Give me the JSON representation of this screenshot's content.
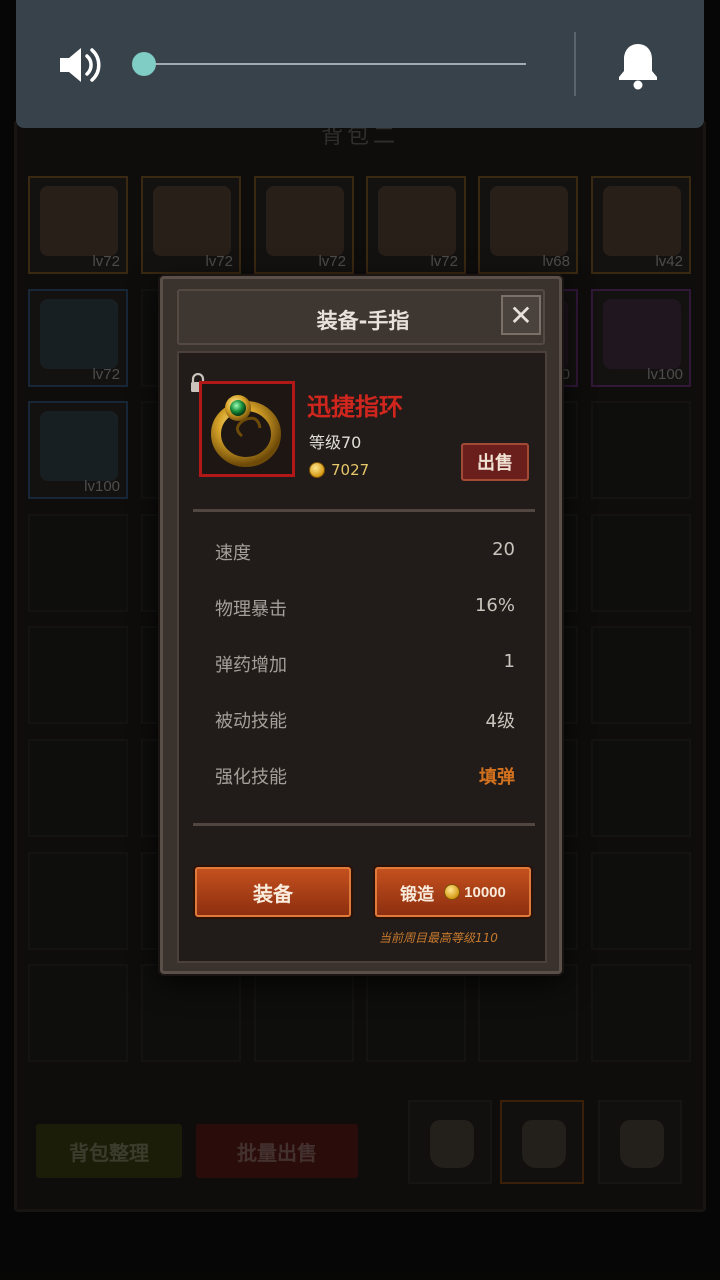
{
  "background": {
    "bag_title": "背包二",
    "grid_rows": [
      [
        {
          "level": "lv72",
          "rarity": "gold",
          "icon": "helmet-icon"
        },
        {
          "level": "lv72",
          "rarity": "gold",
          "icon": "helmet-icon"
        },
        {
          "level": "lv72",
          "rarity": "gold",
          "icon": "helmet-icon"
        },
        {
          "level": "lv72",
          "rarity": "gold",
          "icon": "shield-icon"
        },
        {
          "level": "lv68",
          "rarity": "gold",
          "icon": "gauntlet-icon"
        },
        {
          "level": "lv42",
          "rarity": "gold",
          "icon": "emblem-icon"
        }
      ],
      [
        {
          "level": "lv72",
          "rarity": "blue",
          "icon": "orb-icon"
        },
        {
          "level": "",
          "rarity": "",
          "icon": ""
        },
        {
          "level": "",
          "rarity": "",
          "icon": ""
        },
        {
          "level": "",
          "rarity": "",
          "icon": ""
        },
        {
          "level": "lv100",
          "rarity": "purple",
          "icon": "gem-icon"
        },
        {
          "level": "lv100",
          "rarity": "purple",
          "icon": "sword-icon"
        }
      ],
      [
        {
          "level": "lv100",
          "rarity": "blue",
          "icon": "armor-icon"
        },
        {
          "level": "",
          "rarity": "",
          "icon": ""
        },
        {
          "level": "",
          "rarity": "",
          "icon": ""
        },
        {
          "level": "",
          "rarity": "",
          "icon": ""
        },
        {
          "level": "",
          "rarity": "",
          "icon": ""
        },
        {
          "level": "",
          "rarity": "",
          "icon": ""
        }
      ]
    ],
    "empty_rows": 5,
    "sort_button": "背包整理",
    "bulk_sell_button": "批量出售",
    "bag_tabs": 3,
    "active_bag_tab": 2
  },
  "dialog": {
    "title": "装备-手指",
    "close_glyph": "✕",
    "item": {
      "name": "迅捷指环",
      "level_text": "等级70",
      "price": "7027",
      "icon": "ring-icon",
      "locked": true
    },
    "sell_button": "出售",
    "stats": [
      {
        "name": "速度",
        "value": "20",
        "highlight": false
      },
      {
        "name": "物理暴击",
        "value": "16%",
        "highlight": false
      },
      {
        "name": "弹药增加",
        "value": "1",
        "highlight": false
      },
      {
        "name": "被动技能",
        "value": "4级",
        "highlight": false
      },
      {
        "name": "强化技能",
        "value": "填弹",
        "highlight": true
      }
    ],
    "equip_button": "装备",
    "forge_button": "锻造",
    "forge_cost": "10000",
    "max_level_note": "当前周目最高等级110"
  },
  "volume_overlay": {
    "level": 0.0,
    "speaker_icon": "speaker-icon",
    "bell_icon": "bell-icon",
    "accent_color": "#7fcdc4"
  }
}
